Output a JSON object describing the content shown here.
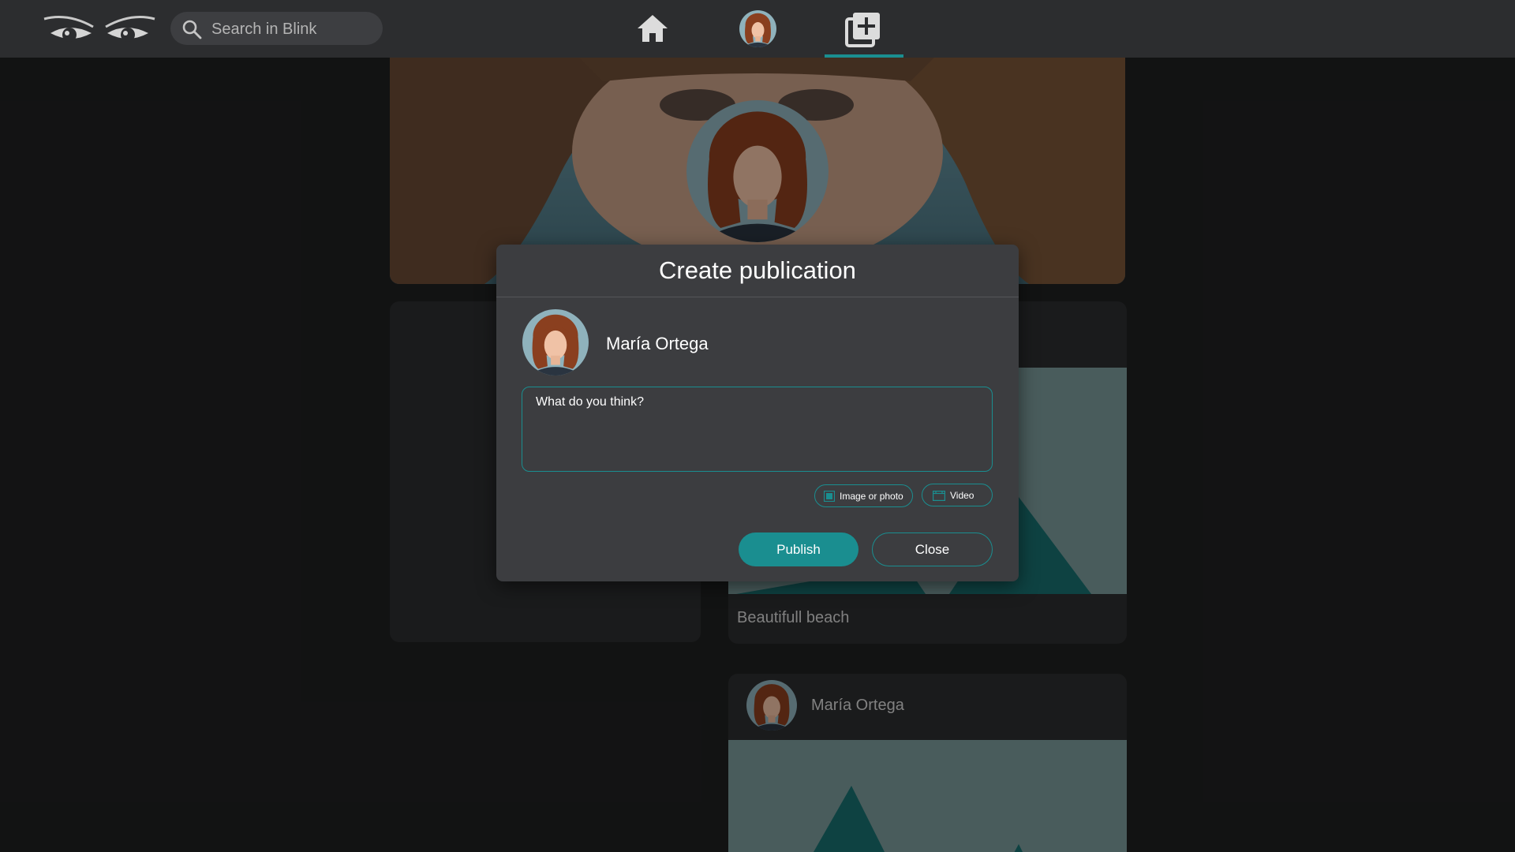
{
  "header": {
    "search_placeholder": "Search in Blink",
    "icons": {
      "logo": "eyes-logo-icon",
      "search": "search-icon",
      "home": "home-icon",
      "create": "add-box-icon"
    },
    "active_nav": "create"
  },
  "profile": {
    "name": "María Ortega"
  },
  "feed": {
    "posts": [
      {
        "author": "María Ortega",
        "caption": "Beautifull beach"
      },
      {
        "author": "María Ortega",
        "caption": ""
      }
    ]
  },
  "modal": {
    "title": "Create publication",
    "author": "María Ortega",
    "placeholder": "What do you think?",
    "attach_image_label": "Image or photo",
    "attach_video_label": "Video",
    "publish_label": "Publish",
    "close_label": "Close"
  },
  "colors": {
    "accent": "#1a8e90",
    "topbar": "#2c2d2f",
    "background": "#1f2021",
    "modal": "#3c3d40",
    "card": "#2c2d2f"
  }
}
